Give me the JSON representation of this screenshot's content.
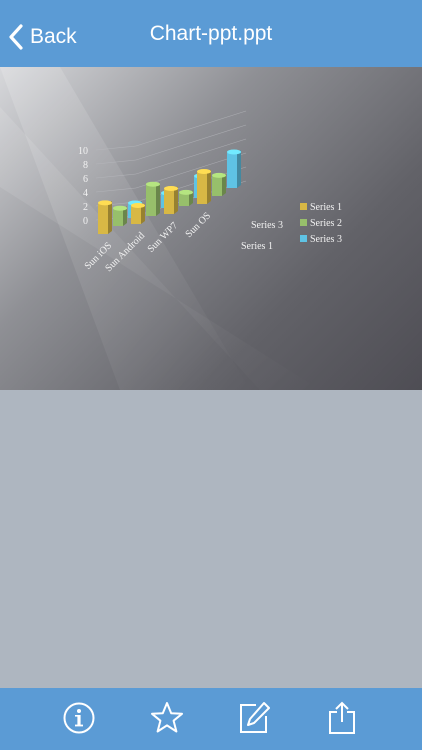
{
  "navbar": {
    "back_label": "Back",
    "title": "Chart-ppt.ppt",
    "back_icon": "chevron-left-icon"
  },
  "toolbar": {
    "items": [
      {
        "name": "info-icon"
      },
      {
        "name": "star-icon"
      },
      {
        "name": "edit-icon"
      },
      {
        "name": "share-icon"
      }
    ]
  },
  "colors": {
    "nav": "#5b9bd5",
    "background": "#aeb6c0",
    "series1": "#d8b845",
    "series2": "#97bf6b",
    "series3": "#5fc3e4"
  },
  "chart_data": {
    "type": "bar",
    "categories": [
      "Sun iOS",
      "Sun Android",
      "Sun WP7",
      "Sun OS"
    ],
    "series": [
      {
        "name": "Series 1",
        "values": [
          4.3,
          2.5,
          3.5,
          4.5
        ]
      },
      {
        "name": "Series 2",
        "values": [
          2.4,
          4.4,
          1.8,
          2.8
        ]
      },
      {
        "name": "Series 3",
        "values": [
          2,
          2,
          3,
          5
        ]
      }
    ],
    "depth_labels": [
      "Series 1",
      "Series 3"
    ],
    "yticks": [
      "0",
      "2",
      "4",
      "6",
      "8",
      "10"
    ],
    "ylim": [
      0,
      10
    ],
    "legend": "right"
  }
}
